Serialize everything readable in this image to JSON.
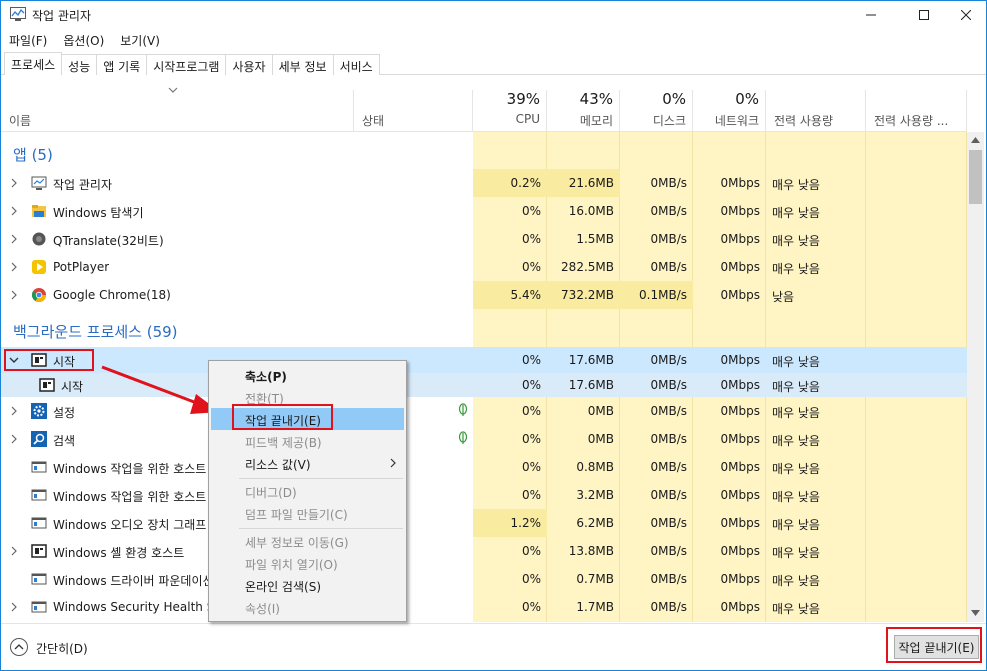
{
  "window": {
    "title": "작업 관리자",
    "icon": "task-manager-icon"
  },
  "menu": [
    "파일(F)",
    "옵션(O)",
    "보기(V)"
  ],
  "tabs": [
    "프로세스",
    "성능",
    "앱 기록",
    "시작프로그램",
    "사용자",
    "세부 정보",
    "서비스"
  ],
  "columns": {
    "name": "이름",
    "status": "상태",
    "cpu": {
      "pct": "39%",
      "label": "CPU"
    },
    "memory": {
      "pct": "43%",
      "label": "메모리"
    },
    "disk": {
      "pct": "0%",
      "label": "디스크"
    },
    "network": {
      "pct": "0%",
      "label": "네트워크"
    },
    "power": "전력 사용량",
    "power_trend": "전력 사용량 ..."
  },
  "groups": {
    "apps": "앱 (5)",
    "background": "백그라운드 프로세스 (59)"
  },
  "apps": [
    {
      "name": "작업 관리자",
      "cpu": "0.2%",
      "mem": "21.6MB",
      "disk": "0MB/s",
      "net": "0Mbps",
      "power": "매우 낮음"
    },
    {
      "name": "Windows 탐색기",
      "cpu": "0%",
      "mem": "16.0MB",
      "disk": "0MB/s",
      "net": "0Mbps",
      "power": "매우 낮음"
    },
    {
      "name": "QTranslate(32비트)",
      "cpu": "0%",
      "mem": "1.5MB",
      "disk": "0MB/s",
      "net": "0Mbps",
      "power": "매우 낮음"
    },
    {
      "name": "PotPlayer",
      "cpu": "0%",
      "mem": "282.5MB",
      "disk": "0MB/s",
      "net": "0Mbps",
      "power": "매우 낮음"
    },
    {
      "name": "Google Chrome(18)",
      "cpu": "5.4%",
      "mem": "732.2MB",
      "disk": "0.1MB/s",
      "net": "0Mbps",
      "power": "낮음"
    }
  ],
  "background": [
    {
      "name": "시작",
      "cpu": "0%",
      "mem": "17.6MB",
      "disk": "0MB/s",
      "net": "0Mbps",
      "power": "매우 낮음"
    },
    {
      "name": "시작",
      "cpu": "0%",
      "mem": "17.6MB",
      "disk": "0MB/s",
      "net": "0Mbps",
      "power": "매우 낮음"
    },
    {
      "name": "설정",
      "cpu": "0%",
      "mem": "0MB",
      "disk": "0MB/s",
      "net": "0Mbps",
      "power": "매우 낮음"
    },
    {
      "name": "검색",
      "cpu": "0%",
      "mem": "0MB",
      "disk": "0MB/s",
      "net": "0Mbps",
      "power": "매우 낮음"
    },
    {
      "name": "Windows 작업을 위한 호스트 프로세스",
      "cpu": "0%",
      "mem": "0.8MB",
      "disk": "0MB/s",
      "net": "0Mbps",
      "power": "매우 낮음"
    },
    {
      "name": "Windows 작업을 위한 호스트 프로세스",
      "cpu": "0%",
      "mem": "3.2MB",
      "disk": "0MB/s",
      "net": "0Mbps",
      "power": "매우 낮음"
    },
    {
      "name": "Windows 오디오 장치 그래프 격리",
      "cpu": "1.2%",
      "mem": "6.2MB",
      "disk": "0MB/s",
      "net": "0Mbps",
      "power": "매우 낮음"
    },
    {
      "name": "Windows 셸 환경 호스트",
      "cpu": "0%",
      "mem": "13.8MB",
      "disk": "0MB/s",
      "net": "0Mbps",
      "power": "매우 낮음"
    },
    {
      "name": "Windows 드라이버 파운데이션",
      "cpu": "0%",
      "mem": "0.7MB",
      "disk": "0MB/s",
      "net": "0Mbps",
      "power": "매우 낮음"
    },
    {
      "name": "Windows Security Health Service",
      "cpu": "0%",
      "mem": "1.7MB",
      "disk": "0MB/s",
      "net": "0Mbps",
      "power": "매우 낮음"
    }
  ],
  "context_menu": [
    "축소(P)",
    "전환(T)",
    "작업 끝내기(E)",
    "피드백 제공(B)",
    "리소스 값(V)",
    "디버그(D)",
    "덤프 파일 만들기(C)",
    "세부 정보로 이동(G)",
    "파일 위치 열기(O)",
    "온라인 검색(S)",
    "속성(I)"
  ],
  "bottom": {
    "collapse": "간단히(D)",
    "end_task": "작업 끝내기(E)"
  },
  "colors": {
    "accent": "#1883d7",
    "group": "#2a6cc4",
    "heat_light": "#fff4c4",
    "heat_medium": "#f9eb9f",
    "selection": "#cce8ff",
    "annotation": "#e0121c"
  }
}
